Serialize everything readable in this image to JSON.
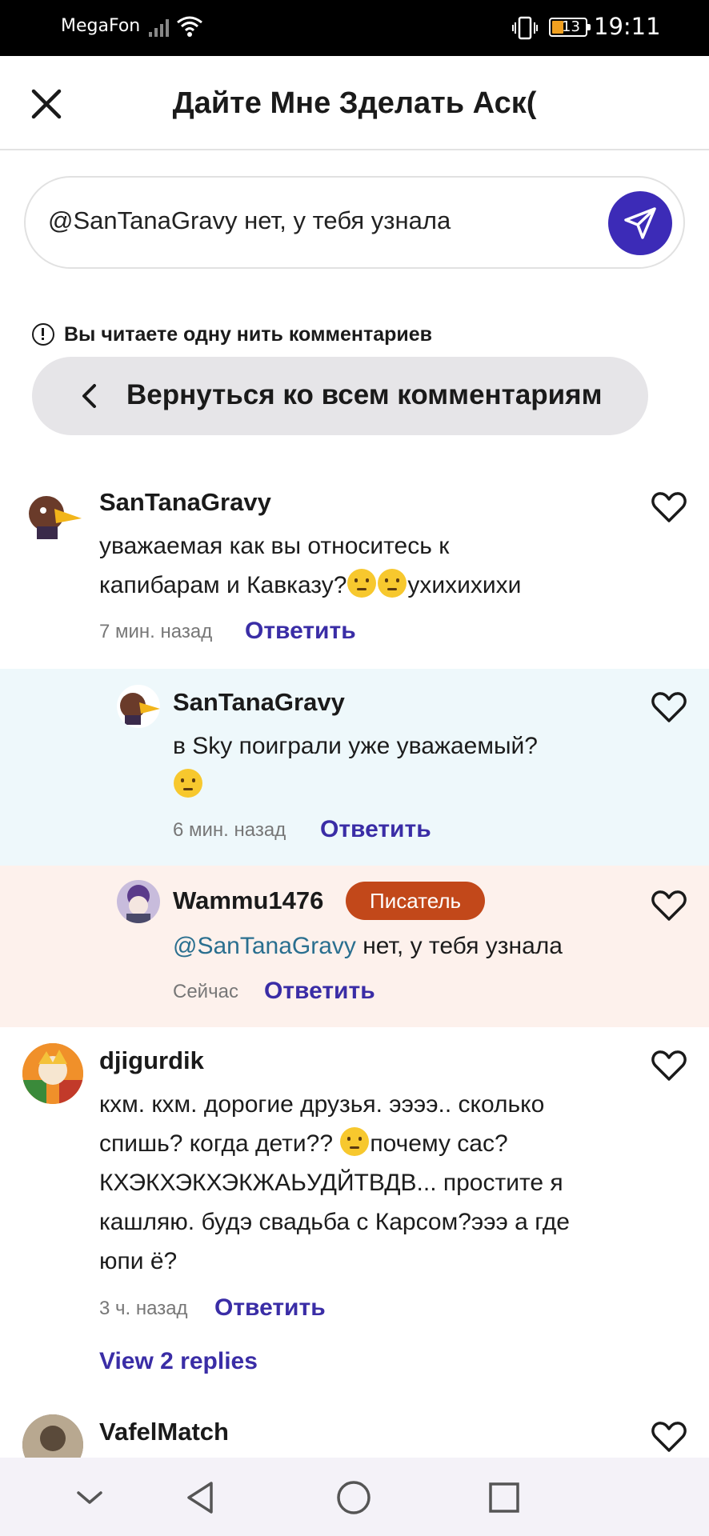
{
  "status_bar": {
    "carrier": "MegaFon",
    "battery": "13",
    "time": "19:11"
  },
  "header": {
    "title": "Дайте Мне Зделать Аск("
  },
  "composer": {
    "value": "@SanTanaGravy нет, у тебя узнала"
  },
  "thread_notice": {
    "text": "Вы читаете одну нить комментариев",
    "back_label": "Вернуться ко всем комментариям"
  },
  "comments": [
    {
      "username": "SanTanaGravy",
      "text_line1": "уважаемая как вы относитесь к",
      "text_line2_a": "капибарам и Кавказу?",
      "text_line2_b": "ухихихихи",
      "time": "7 мин. назад",
      "reply_label": "Ответить"
    },
    {
      "username": "SanTanaGravy",
      "text_line1": "в Sky поиграли уже уважаемый?",
      "time": "6 мин. назад",
      "reply_label": "Ответить",
      "background": "#eef8fb"
    },
    {
      "username": "Wammu1476",
      "badge": "Писатель",
      "mention": "@SanTanaGravy",
      "text_rest": " нет, у тебя узнала",
      "time": "Сейчас",
      "reply_label": "Ответить",
      "background": "#fdf1ec"
    },
    {
      "username": "djigurdik",
      "text_line1": "кхм. кхм. дорогие друзья. ээээ.. сколько",
      "text_line2_a": "спишь? когда дети?? ",
      "text_line2_b": "почему сас?",
      "text_line3": "КХЭКХЭКХЭКЖАЬУДЙТВДВ... простите я",
      "text_line4": "кашляю. будэ свадьба с Карсом?эээ а где",
      "text_line5": "юпи ё?",
      "time": "3 ч. назад",
      "reply_label": "Ответить",
      "view_replies": "View 2 replies"
    },
    {
      "username": "VafelMatch"
    }
  ],
  "colors": {
    "accent": "#3c2bb7",
    "link": "#3a2da6",
    "badge": "#c2481a",
    "reply_bg_blue": "#eef8fb",
    "reply_bg_peach": "#fdf1ec"
  },
  "icons": [
    "close-icon",
    "send-icon",
    "info-icon",
    "chevron-left-icon",
    "heart-icon",
    "nav-back-icon",
    "nav-home-icon",
    "nav-recents-icon",
    "nav-collapse-icon"
  ]
}
